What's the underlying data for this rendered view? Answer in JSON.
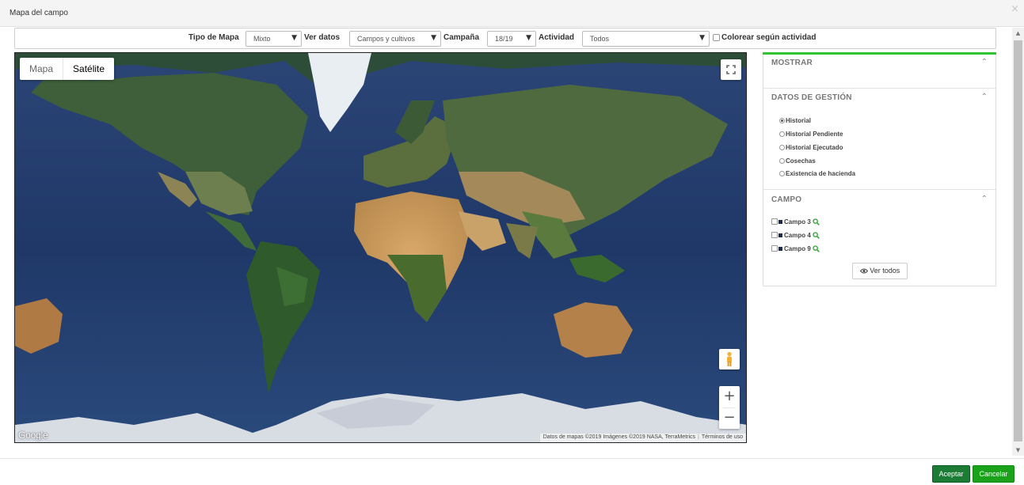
{
  "modal": {
    "title": "Mapa del campo",
    "close_glyph": "×"
  },
  "toolbar": {
    "tipo_mapa_label": "Tipo de Mapa",
    "tipo_mapa_value": "Mixto",
    "ver_datos_label": "Ver datos",
    "ver_datos_value": "Campos y cultivos",
    "campana_label": "Campaña",
    "campana_value": "18/19",
    "actividad_label": "Actividad",
    "actividad_value": "Todos",
    "colorear_label": "Colorear según actividad",
    "colorear_checked": false,
    "caret_glyph": "▼"
  },
  "map": {
    "type_buttons": [
      "Mapa",
      "Satélite"
    ],
    "active_type": "Satélite",
    "zoom_in": "+",
    "zoom_out": "−",
    "logo": "Google",
    "attribution": "Datos de mapas ©2019 Imágenes ©2019 NASA, TerraMetrics",
    "terms": "Términos de uso",
    "icons": [
      "fullscreen-icon",
      "pegman-icon"
    ]
  },
  "panel": {
    "accent_color": "#32c532",
    "chevron_glyph": "⌃",
    "sections": {
      "mostrar": {
        "title": "MOSTRAR"
      },
      "gestion": {
        "title": "DATOS DE GESTIÓN",
        "options": [
          "Historial",
          "Historial Pendiente",
          "Historial Ejecutado",
          "Cosechas",
          "Existencia de hacienda"
        ],
        "selected": "Historial"
      },
      "campo": {
        "title": "CAMPO",
        "items": [
          "Campo 3",
          "Campo 4",
          "Campo 9"
        ],
        "ver_todos": "Ver todos"
      }
    }
  },
  "scrollbar": {
    "up_glyph": "▲",
    "down_glyph": "▼"
  },
  "footer": {
    "accept": "Aceptar",
    "cancel": "Cancelar",
    "accept_color": "#1c7b35",
    "cancel_color": "#1aa31a"
  }
}
